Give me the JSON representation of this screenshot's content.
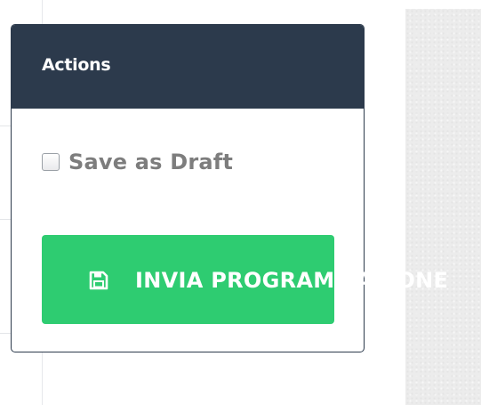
{
  "card": {
    "title": "Actions",
    "draft": {
      "label": "Save as Draft",
      "checked": false
    },
    "submit": {
      "label": "INVIA PROGRAMMAZIONE",
      "icon": "floppy-disk-icon"
    }
  },
  "colors": {
    "header_bg": "#2c3a4c",
    "button_bg": "#2ecc71",
    "label_gray": "#7d7d7d"
  }
}
